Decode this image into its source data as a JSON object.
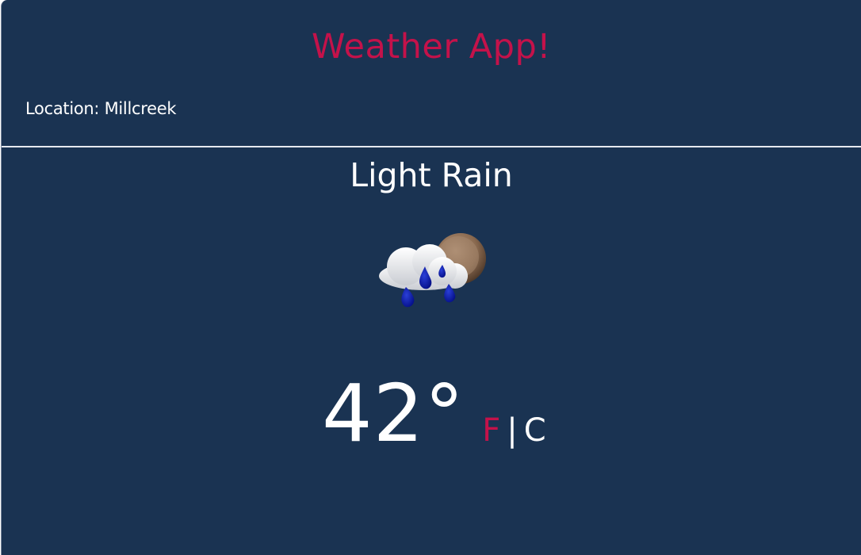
{
  "header": {
    "title": "Weather App!",
    "location_label": "Location: Millcreek"
  },
  "current": {
    "condition": "Light Rain",
    "icon": "cloud-rain-moon-icon",
    "temperature": "42°",
    "units": {
      "fahrenheit": "F",
      "separator": "|",
      "celsius": "C",
      "active": "F"
    }
  },
  "colors": {
    "background": "#1a3352",
    "accent": "#c4124a",
    "text": "#ffffff"
  }
}
